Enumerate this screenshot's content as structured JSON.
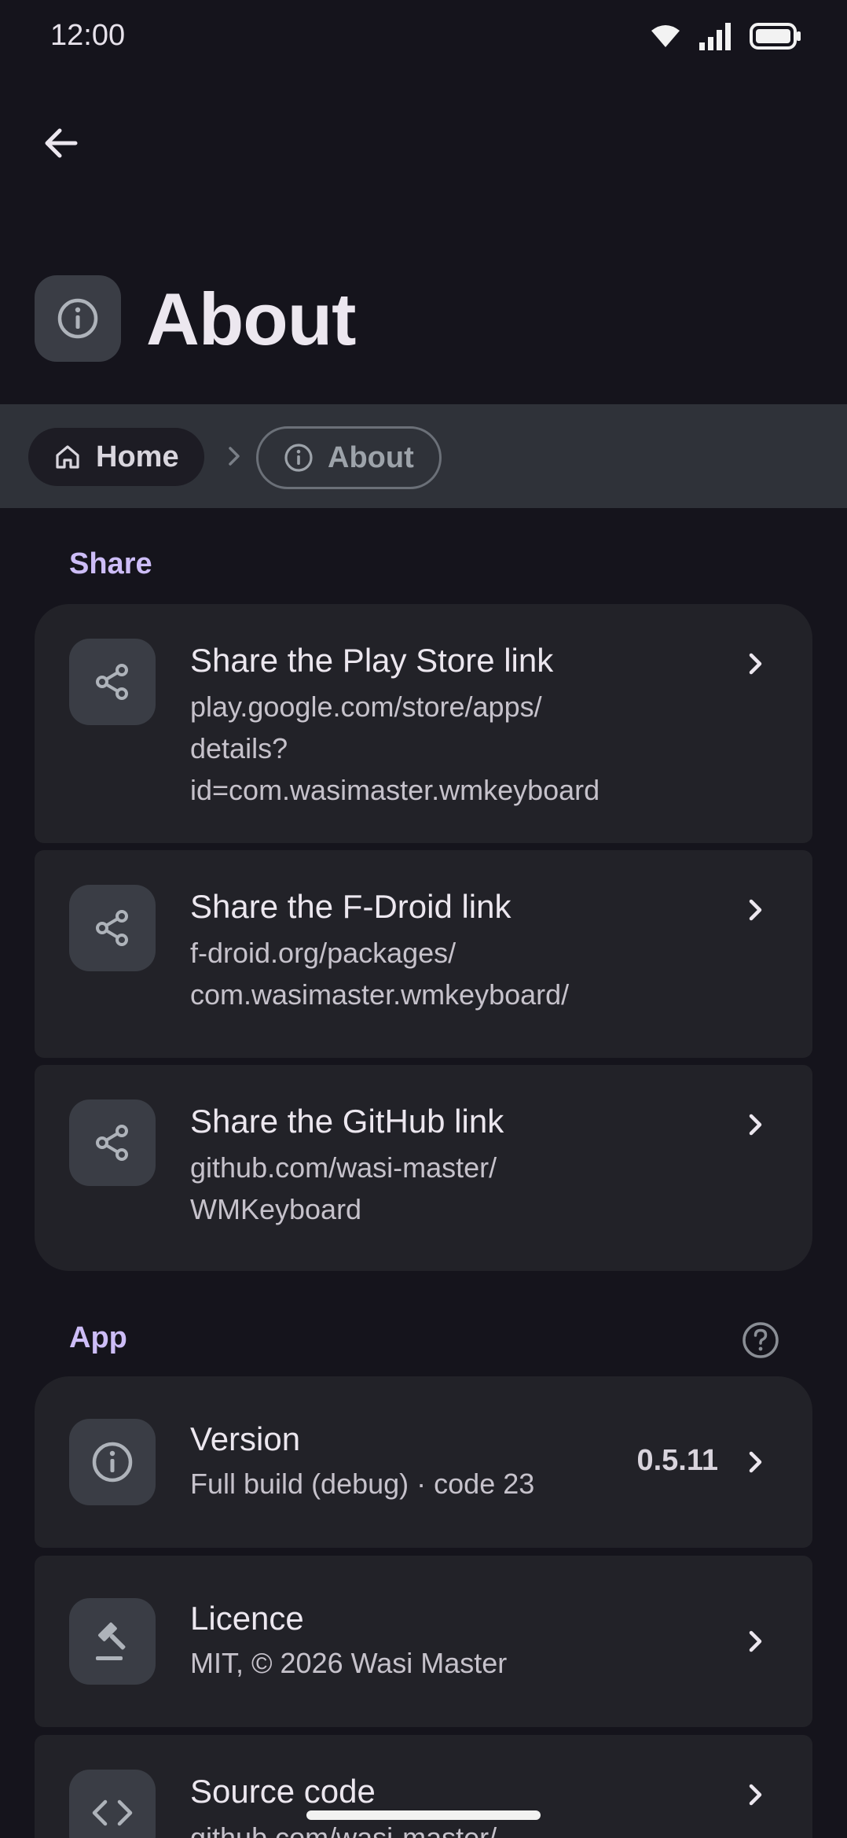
{
  "status_bar": {
    "time": "12:00"
  },
  "header": {
    "title": "About",
    "title_icon": "info-icon",
    "back_icon": "arrow-left-icon"
  },
  "breadcrumb": {
    "items": [
      {
        "label": "Home",
        "icon": "home-icon"
      },
      {
        "label": "About",
        "icon": "info-icon"
      }
    ]
  },
  "share_section": {
    "title": "Share",
    "items": [
      {
        "title": "Share the Play Store link",
        "subtitle": "play.google.com/store/apps/\ndetails?\nid=com.wasimaster.wmkeyboard",
        "icon": "share-icon"
      },
      {
        "title": "Share the F-Droid link",
        "subtitle": "f-droid.org/packages/\ncom.wasimaster.wmkeyboard/",
        "icon": "share-icon"
      },
      {
        "title": "Share the GitHub link",
        "subtitle": "github.com/wasi-master/\nWMKeyboard",
        "icon": "share-icon"
      }
    ]
  },
  "app_section": {
    "title": "App",
    "help_icon": "help-circle-icon",
    "items": [
      {
        "title": "Version",
        "subtitle": "Full build (debug) · code 23",
        "value": "0.5.11",
        "icon": "info-icon"
      },
      {
        "title": "Licence",
        "subtitle": "MIT, © 2026 Wasi Master",
        "icon": "gavel-icon"
      },
      {
        "title": "Source code",
        "subtitle": "github.com/wasi-master/",
        "icon": "code-icon"
      }
    ]
  },
  "colors": {
    "background": "#15141c",
    "card": "#222228",
    "accent": "#cdbdf7",
    "breadcrumb_bar": "#2f3239"
  }
}
